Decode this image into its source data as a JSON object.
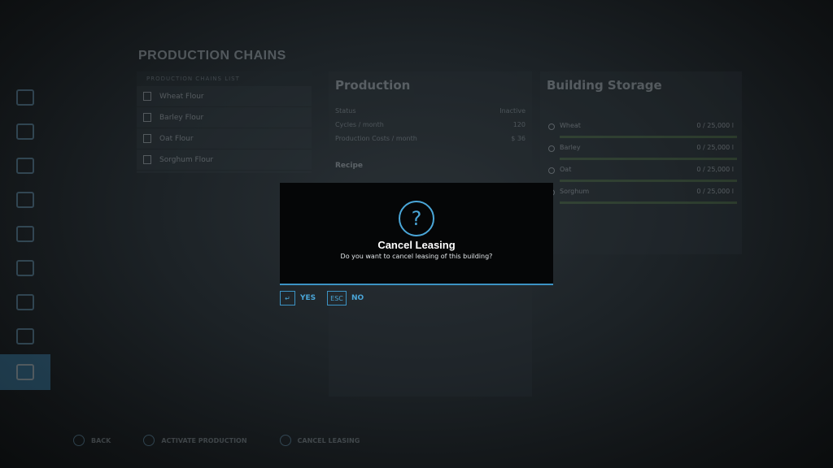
{
  "background": {
    "title": "PRODUCTION CHAINS",
    "list_header": "PRODUCTION CHAINS LIST",
    "list_items": [
      "Wheat Flour",
      "Barley Flour",
      "Oat Flour",
      "Sorghum Flour"
    ],
    "production": {
      "title": "Production",
      "rows": [
        {
          "label": "Status",
          "value": "Inactive"
        },
        {
          "label": "Cycles / month",
          "value": "120"
        },
        {
          "label": "Production Costs / month",
          "value": "$ 36"
        }
      ],
      "recipe_label": "Recipe"
    },
    "storage": {
      "title": "Building Storage",
      "items": [
        {
          "label": "Wheat",
          "value": "0 / 25,000 l"
        },
        {
          "label": "Barley",
          "value": "0 / 25,000 l"
        },
        {
          "label": "Oat",
          "value": "0 / 25,000 l"
        },
        {
          "label": "Sorghum",
          "value": "0 / 25,000 l"
        }
      ]
    },
    "footer_hints": [
      "BACK",
      "ACTIVATE PRODUCTION",
      "CANCEL LEASING"
    ]
  },
  "dialog": {
    "icon": "question-mark-icon",
    "icon_glyph": "?",
    "title": "Cancel Leasing",
    "message": "Do you want to cancel leasing of this building?"
  },
  "buttons": {
    "yes": {
      "key": "↵",
      "label": "YES"
    },
    "no": {
      "key": "ESC",
      "label": "NO"
    }
  },
  "colors": {
    "accent": "#4aa6d8",
    "dialog_bg": "#050607",
    "sidebar_active": "#3e8fbf"
  }
}
